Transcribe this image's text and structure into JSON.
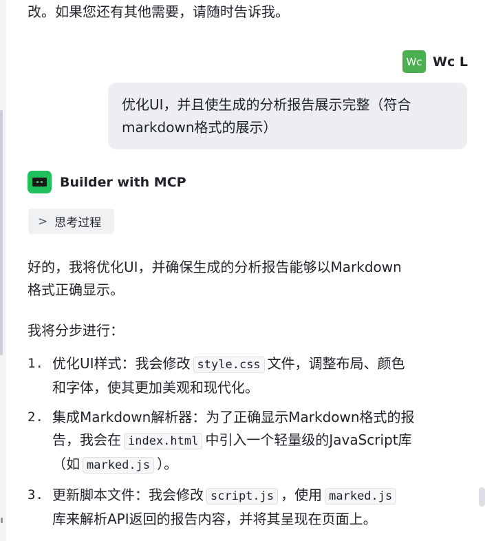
{
  "previous_message": {
    "text": "改。如果您还有其他需要，请随时告诉我。"
  },
  "user": {
    "avatar_text": "Wc",
    "name": "Wc L",
    "message_line1": "优化UI，并且使生成的分析报告展示完整（符合",
    "message_line2": "markdown格式的展示）",
    "avatar_color": "#4caf50"
  },
  "bot": {
    "name": "Builder with MCP",
    "avatar_color": "#20c05c",
    "think_label": "思考过程",
    "intro_line1": "好的，我将优化UI，并确保生成的分析报告能够以Markdown",
    "intro_line2": "格式正确显示。",
    "steps_intro": "我将分步进行：",
    "steps": [
      {
        "num": "1.",
        "a": "优化UI样式：我会修改",
        "code1": "style.css",
        "b": "文件，调整布局、颜色",
        "c": "和字体，使其更加美观和现代化。"
      },
      {
        "num": "2.",
        "a": "集成Markdown解析器：为了正确显示Markdown格式的报",
        "b": "告，我会在",
        "code1": "index.html",
        "c": "中引入一个轻量级的JavaScript库",
        "d": "（如",
        "code2": "marked.js",
        "e": "）。"
      },
      {
        "num": "3.",
        "a": "更新脚本文件：我会修改",
        "code1": "script.js",
        "b": "，使用",
        "code2": "marked.js",
        "c": "库来解析API返回的报告内容，并将其呈现在页面上。"
      }
    ]
  }
}
